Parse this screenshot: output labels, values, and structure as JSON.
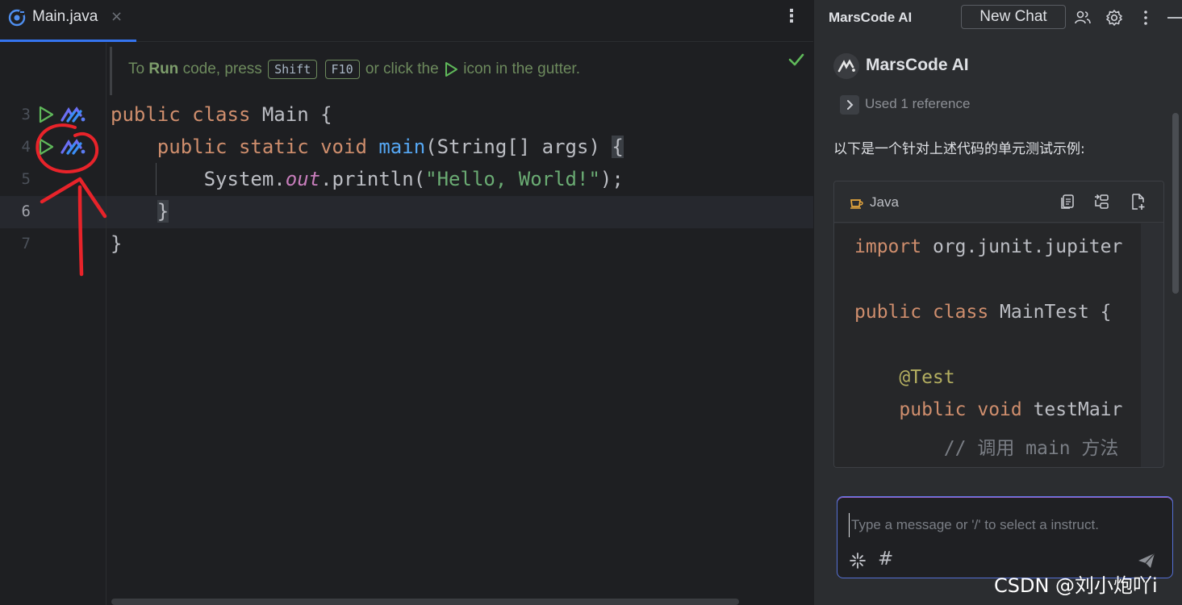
{
  "editor": {
    "tab": {
      "label": "Main.java",
      "close": "×",
      "icon": "java-file-icon"
    },
    "more_icon": "⋮",
    "hint": {
      "prefix": "To ",
      "run_word": "Run",
      "middle": " code, press ",
      "key1": "Shift",
      "key2": "F10",
      "suffix1": " or click the ",
      "suffix2": " icon in the gutter."
    },
    "line_numbers": [
      "3",
      "4",
      "5",
      "6",
      "7"
    ],
    "current_line": "6",
    "code": {
      "l3": {
        "kw1": "public",
        "kw2": "class",
        "rest": " Main {"
      },
      "l4": {
        "kw1": "public",
        "kw2": "static",
        "kw3": "void",
        "fn": "main",
        "rest": "(String[] args) ",
        "brace": "{"
      },
      "l5": {
        "pre": "System.",
        "field": "out",
        "mid": ".println(",
        "str": "\"Hello, World!\"",
        "end": ");"
      },
      "l6": {
        "brace": "}"
      },
      "l7": {
        "brace": "}"
      }
    },
    "colors": {
      "keyword": "#cf8e6d",
      "function": "#56a8f5",
      "string": "#6aab73",
      "field": "#c77dbb",
      "annotation_mark": "#e8232a"
    }
  },
  "panel": {
    "title": "MarsCode AI",
    "new_chat_label": "New Chat",
    "header_icons": [
      "people-icon",
      "gear-icon",
      "more-icon",
      "minimize-icon"
    ],
    "message": {
      "author": "MarsCode AI",
      "reference": "Used 1 reference",
      "text": "以下是一个针对上述代码的单元测试示例:",
      "code_block": {
        "language": "Java",
        "lines": {
          "l1_kw": "import",
          "l1_rest": " org.junit.jupiter",
          "l2_kw1": "public",
          "l2_kw2": "class",
          "l2_rest": " MainTest {",
          "l3_ann": "@Test",
          "l4_kw1": "public",
          "l4_kw2": "void",
          "l4_rest": " testMair",
          "l5_cmt": "// 调用 main 方法"
        }
      }
    },
    "input": {
      "placeholder": "Type a message or '/' to select a instruct."
    },
    "accent": "#5570d4"
  },
  "watermark": "CSDN @刘小炮吖i"
}
